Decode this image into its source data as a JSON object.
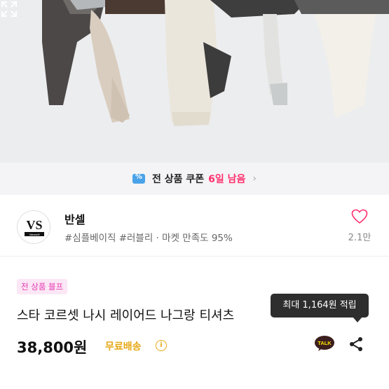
{
  "hero": {
    "image_alt": ""
  },
  "icons": {
    "expand": "expand-icon",
    "coupon": "coupon-icon",
    "chevron": "chevron-right-icon",
    "heart": "heart-icon",
    "info": "info-icon",
    "talk": "kakao-talk-icon",
    "share": "share-icon"
  },
  "coupon": {
    "prefix": "전 상품 쿠폰",
    "highlight": "6일 남음",
    "chevron": "›"
  },
  "shop": {
    "logo_text": "VS",
    "logo_subtext": "Vanssell",
    "name": "반셀",
    "tags": "#심플베이직 #러블리 · 마켓 만족도 95%",
    "likes": "2.1만"
  },
  "product": {
    "badge": "전 상품 블프",
    "title": "스타 코르셋 나시 레이어드 나그랑 티셔츠",
    "price": "38,800원",
    "shipping": "무료배송",
    "info": "i"
  },
  "tooltip": {
    "text": "최대 1,164원 적립"
  },
  "talk_label": "TALK",
  "colors": {
    "accent_pink": "#ff2f6e",
    "badge_pink": "#e53ab1",
    "shipping_yellow": "#e6a817",
    "kakao_yellow": "#fee500"
  }
}
